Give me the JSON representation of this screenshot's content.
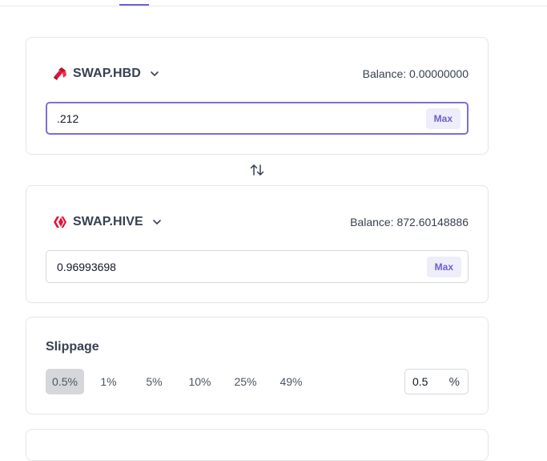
{
  "from": {
    "token": "SWAP.HBD",
    "icon": "hbd-token-icon",
    "balance": "Balance: 0.00000000",
    "amount": ".212",
    "max_label": "Max"
  },
  "to": {
    "token": "SWAP.HIVE",
    "icon": "hive-token-icon",
    "balance": "Balance: 872.60148886",
    "amount": "0.96993698",
    "max_label": "Max"
  },
  "slippage": {
    "title": "Slippage",
    "options": [
      "0.5%",
      "1%",
      "5%",
      "10%",
      "25%",
      "49%"
    ],
    "selected": "0.5%",
    "custom_value": "0.5",
    "unit": "%"
  },
  "colors": {
    "accent": "#7c6fd6",
    "max_bg": "#eeedfa",
    "hbd_red": "#e31337",
    "hive_red": "#e31337"
  }
}
